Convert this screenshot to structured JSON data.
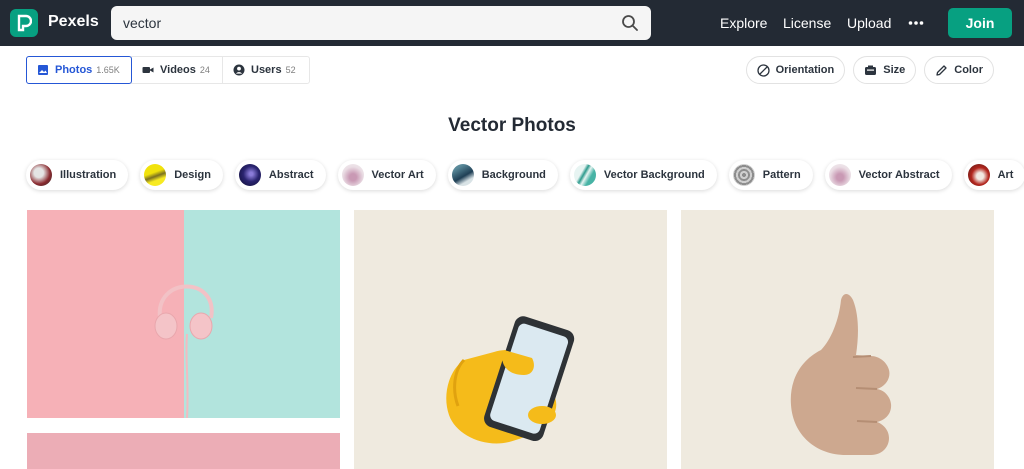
{
  "header": {
    "brand": "Pexels",
    "search_value": "vector",
    "nav": [
      "Explore",
      "License",
      "Upload"
    ],
    "join_label": "Join",
    "accent_color": "#07a081"
  },
  "media_tabs": [
    {
      "label": "Photos",
      "count": "1.65K",
      "icon": "image-icon",
      "active": true
    },
    {
      "label": "Videos",
      "count": "24",
      "icon": "video-camera-icon",
      "active": false
    },
    {
      "label": "Users",
      "count": "52",
      "icon": "user-icon",
      "active": false
    }
  ],
  "filters": [
    {
      "label": "Orientation",
      "icon": "orientation-icon"
    },
    {
      "label": "Size",
      "icon": "size-icon"
    },
    {
      "label": "Color",
      "icon": "pencil-icon"
    }
  ],
  "page_title": "Vector Photos",
  "related_searches": [
    "Illustration",
    "Design",
    "Abstract",
    "Vector Art",
    "Background",
    "Vector Background",
    "Pattern",
    "Vector Abstract",
    "Art"
  ]
}
